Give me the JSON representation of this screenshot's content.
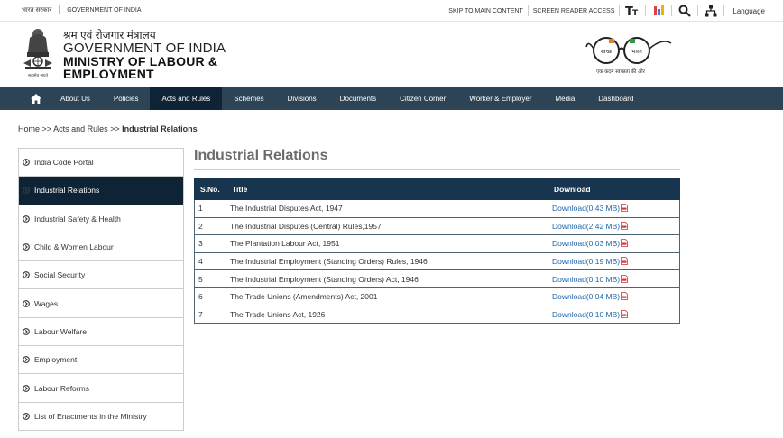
{
  "topbar": {
    "govt_hindi": "भारत सरकार",
    "govt_english": "GOVERNMENT OF INDIA",
    "skip_main": "SKIP TO MAIN CONTENT",
    "screen_reader": "SCREEN READER ACCESS",
    "language": "Language"
  },
  "header": {
    "hindi_name": "श्रम एवं रोजगार मंत्रालय",
    "gov_of_india": "GOVERNMENT OF INDIA",
    "ministry_line1": "MINISTRY OF LABOUR &",
    "ministry_line2": "EMPLOYMENT",
    "emblem_motto": "सत्यमेव जयते",
    "swachh_logo_text": "स्वच्छ भारत",
    "swachh_tagline": "एक कदम स्वच्छता की ओर"
  },
  "nav": {
    "items": [
      {
        "label": "About Us"
      },
      {
        "label": "Policies"
      },
      {
        "label": "Acts and Rules"
      },
      {
        "label": "Schemes"
      },
      {
        "label": "Divisions"
      },
      {
        "label": "Documents"
      },
      {
        "label": "Citizen Corner"
      },
      {
        "label": "Worker & Employer"
      },
      {
        "label": "Media"
      },
      {
        "label": "Dashboard"
      }
    ],
    "active_index": 2
  },
  "breadcrumb": {
    "home": "Home",
    "sep1": ">>",
    "acts": "Acts and Rules",
    "sep2": ">>",
    "current": "Industrial Relations"
  },
  "sidebar": {
    "items": [
      {
        "label": "India Code Portal"
      },
      {
        "label": "Industrial Relations"
      },
      {
        "label": "Industrial Safety & Health"
      },
      {
        "label": "Child & Women Labour"
      },
      {
        "label": "Social Security"
      },
      {
        "label": "Wages"
      },
      {
        "label": "Labour Welfare"
      },
      {
        "label": "Employment"
      },
      {
        "label": "Labour Reforms"
      },
      {
        "label": "List of Enactments in the Ministry"
      }
    ],
    "active_index": 1
  },
  "main": {
    "title": "Industrial Relations",
    "table": {
      "headers": {
        "sno": "S.No.",
        "title": "Title",
        "download": "Download"
      },
      "rows": [
        {
          "sno": "1",
          "title": "The Industrial Disputes Act, 1947",
          "download": "Download(0.43 MB)"
        },
        {
          "sno": "2",
          "title": "The Industrial Disputes (Central) Rules,1957",
          "download": "Download(2.42 MB)"
        },
        {
          "sno": "3",
          "title": "The Plantation Labour Act, 1951",
          "download": "Download(0.03 MB)"
        },
        {
          "sno": "4",
          "title": "The Industrial Employment (Standing Orders) Rules, 1946",
          "download": "Download(0.19 MB)"
        },
        {
          "sno": "5",
          "title": "The Industrial Employment (Standing Orders) Act, 1946",
          "download": "Download(0.10 MB)"
        },
        {
          "sno": "6",
          "title": "The Trade Unions (Amendments) Act, 2001",
          "download": "Download(0.04 MB)"
        },
        {
          "sno": "7",
          "title": "The Trade Unions Act, 1926",
          "download": "Download(0.10 MB)"
        }
      ]
    }
  },
  "colors": {
    "nav_bg": "#2c4456",
    "nav_active": "#0f2336",
    "table_header": "#17354f",
    "link": "#2266aa",
    "title_gray": "#6c6c6c"
  }
}
